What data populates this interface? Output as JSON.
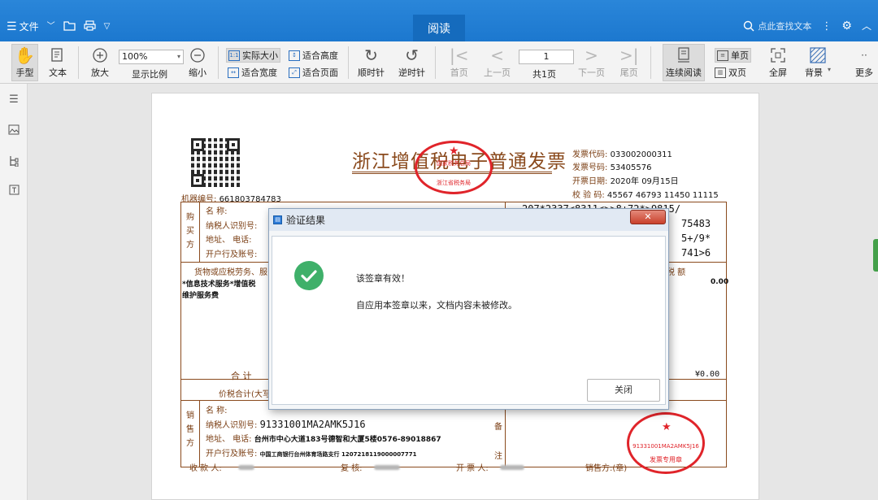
{
  "titlebar": {
    "file_menu": "文件",
    "center_tab": "阅读",
    "search_placeholder": "点此查找文本"
  },
  "toolbar": {
    "hand": "手型",
    "text": "文本",
    "zoom_in": "放大",
    "zoom_value": "100%",
    "show_ratio": "显示比例",
    "zoom_out": "缩小",
    "actual_size": "实际大小",
    "fit_height": "适合高度",
    "fit_width": "适合宽度",
    "fit_page": "适合页面",
    "rotate_cw": "顺时针",
    "rotate_ccw": "逆时针",
    "first_page": "首页",
    "prev_page": "上一页",
    "page_value": "1",
    "page_total": "共1页",
    "next_page": "下一页",
    "last_page": "尾页",
    "continuous": "连续阅读",
    "single_page": "单页",
    "double_page": "双页",
    "fullscreen": "全屏",
    "background": "背景",
    "more": "更多"
  },
  "invoice": {
    "title": "浙江增值税电子普通发票",
    "code_label": "发票代码:",
    "code_value": "033002000311",
    "number_label": "发票号码:",
    "number_value": "53405576",
    "date_label": "开票日期:",
    "date_value": "2020年 09月15日",
    "check_label": "校 验 码:",
    "check_value": "45567 46793 11450 11115",
    "machine_label": "机器编号:",
    "machine_value": "661803784783",
    "buyer_side": [
      "购",
      "买",
      "方"
    ],
    "buyer_name_label": "名        称:",
    "buyer_tax_label": "纳税人识别号:",
    "buyer_addr_label": "地址、 电话:",
    "buyer_bank_label": "开户行及账号:",
    "cipher_lines": [
      "207*2337<8311<>>8+72*>9815/",
      "75483",
      "5+/9*",
      "741>6"
    ],
    "goods_header": "货物或应税劳务、服",
    "tax_header": "税  额",
    "item_line1": "*信息技术服务*增值税",
    "item_line2": "维护服务费",
    "tax_value": "0.00",
    "total_label": "合    计",
    "total_tax": "¥0.00",
    "price_total_label": "价税合计(大写)",
    "seller_side": [
      "销",
      "售",
      "方"
    ],
    "seller_name_label": "名        称:",
    "seller_tax_label": "纳税人识别号:",
    "seller_tax_value": "91331001MA2AMK5J16",
    "seller_addr_label": "地址、 电话:",
    "seller_addr_value": "台州市中心大道183号德智和大厦5楼0576-89018867",
    "seller_bank_label": "开户行及账号:",
    "seller_bank_value": "中国工商银行台州体育场路支行 1207218119000007771",
    "remark_side": [
      "备",
      "注"
    ],
    "payee_label": "收 款 人:",
    "reviewer_label": "复  核:",
    "issuer_label": "开 票 人:",
    "seller_seal_label": "销售方:(章)",
    "seal_top_text": "国家税务总局",
    "seal_bottom_text": "浙江省税务局",
    "seller_seal_number": "91331001MA2AMK5J16",
    "seller_seal_bottom": "发票专用章"
  },
  "dialog": {
    "title": "验证结果",
    "message1": "该签章有效！",
    "message2": "自应用本签章以来，文档内容未被修改。",
    "close_button": "关闭"
  }
}
